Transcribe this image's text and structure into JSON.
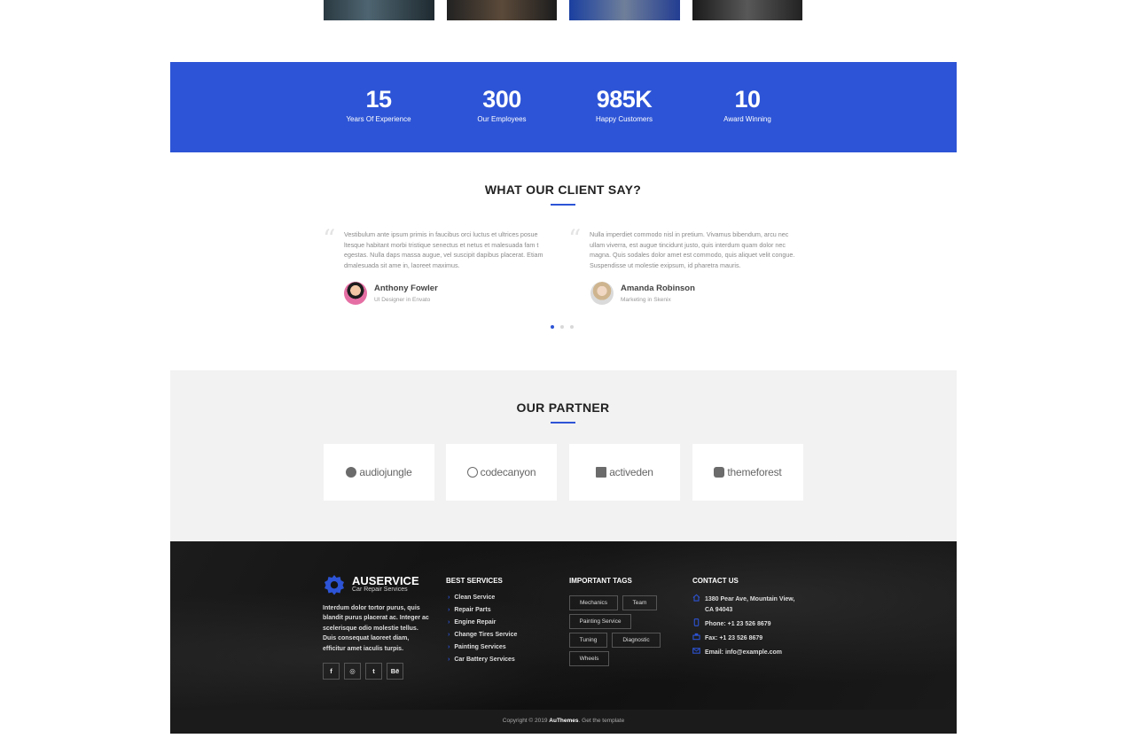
{
  "stats": [
    {
      "value": "15",
      "label": "Years Of Experience"
    },
    {
      "value": "300",
      "label": "Our Employees"
    },
    {
      "value": "985K",
      "label": "Happy Customers"
    },
    {
      "value": "10",
      "label": "Award Winning"
    }
  ],
  "testimonials": {
    "title": "WHAT OUR CLIENT SAY?",
    "items": [
      {
        "text": "Vestibulum ante ipsum primis in faucibus orci luctus et ultrices posue ltesque habitant morbi tristique senectus et netus et malesuada fam t egestas. Nulla daps massa augue, vel suscipit dapibus placerat. Etiam dmalesuada sit ame in, laoreet maximus.",
        "name": "Anthony Fowler",
        "role": "UI Designer in Envato"
      },
      {
        "text": "Nulla imperdiet commodo nisl in pretium. Vivamus bibendum, arcu nec ullam viverra, est augue tincidunt justo, quis interdum quam dolor nec magna. Quis sodales dolor amet est commodo, quis aliquet velit congue. Suspendisse ut molestie exipsum, id pharetra mauris.",
        "name": "Amanda Robinson",
        "role": "Marketing in Skenix"
      }
    ],
    "dots": [
      true,
      false,
      false
    ]
  },
  "partners": {
    "title": "OUR PARTNER",
    "items": [
      "audiojungle",
      "codecanyon",
      "activeden",
      "themeforest"
    ]
  },
  "footer": {
    "brand": {
      "name": "AUSERVICE",
      "subtitle": "Car Repair Services"
    },
    "about": "Interdum dolor tortor purus, quis blandit purus placerat ac. Integer ac scelerisque odio molestie tellus. Duis consequat laoreet diam, efficitur amet iaculis turpis.",
    "social": [
      "f",
      "◎",
      "t",
      "Bē"
    ],
    "services_title": "BEST SERVICES",
    "services": [
      "Clean Service",
      "Repair Parts",
      "Engine Repair",
      "Change Tires Service",
      "Painting Services",
      "Car Battery Services"
    ],
    "tags_title": "IMPORTANT TAGS",
    "tags": [
      "Mechanics",
      "Team",
      "Painting Service",
      "Tuning",
      "Diagnostic",
      "Wheels"
    ],
    "contact_title": "CONTACT US",
    "contact": {
      "address_line1": "1380 Pear Ave, Mountain View,",
      "address_line2": "CA 94043",
      "phone": "Phone: +1 23 526 8679",
      "fax": "Fax: +1 23 526 8679",
      "email": "Email: info@example.com"
    },
    "copyright_prefix": "Copyright © 2019",
    "copyright_brand": "AuThemes",
    "copyright_suffix": ". Get the template"
  },
  "colors": {
    "accent": "#2d54d6",
    "footer_bg": "#111111",
    "partner_bg": "#f2f2f2"
  }
}
